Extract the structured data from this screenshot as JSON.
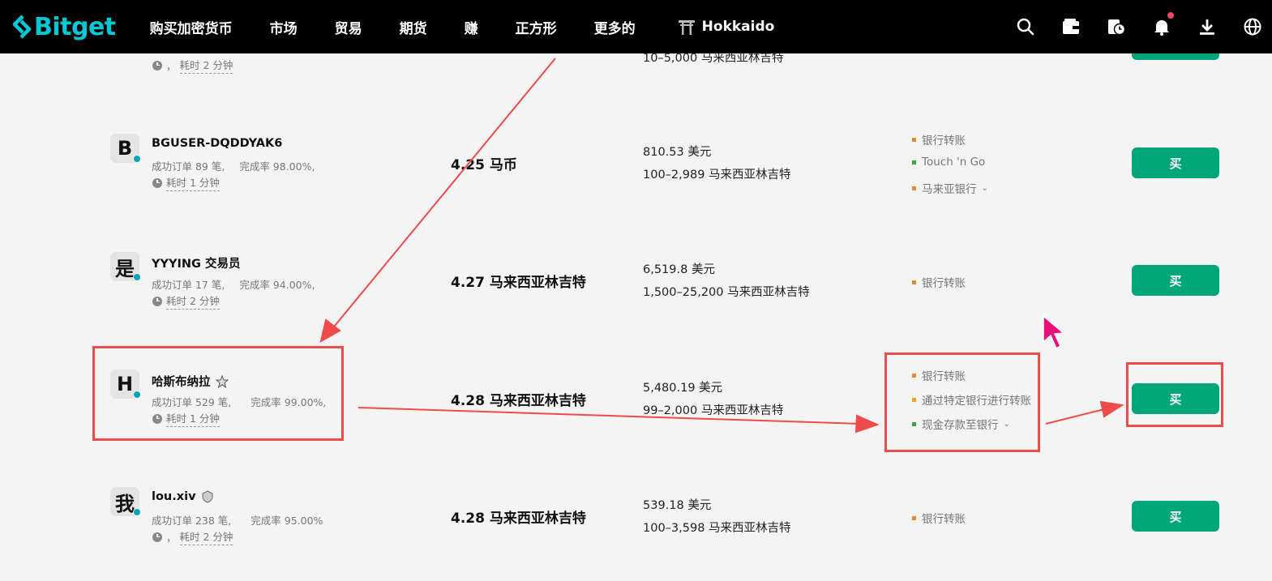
{
  "brand": {
    "name": "Bitget",
    "color": "#00c8d4"
  },
  "nav": {
    "items": [
      "购买加密货币",
      "市场",
      "贸易",
      "期货",
      "赚",
      "正方形",
      "更多的"
    ],
    "community": "Hokkaido"
  },
  "top_icons": [
    "search-icon",
    "wallet-icon",
    "order-history-icon",
    "bell-icon",
    "download-icon",
    "globe-icon"
  ],
  "top_row": {
    "time_prefix": "，",
    "time": "耗时 2 分钟",
    "limit": "10–5,000 马来西亚林吉特"
  },
  "offers": [
    {
      "avatar": "B",
      "name": "BGUSER-DQDDYAK6",
      "badge": "",
      "orders": "成功订单 89 笔,",
      "completion": "完成率 98.00%,",
      "time_prefix": "",
      "time": "耗时 1 分钟",
      "price": "4.25 马币",
      "available": "810.53 美元",
      "limit": "100–2,989 马来西亚林吉特",
      "payments": [
        {
          "label": "银行转账",
          "color": "#e8892a"
        },
        {
          "label": "Touch 'n Go",
          "color": "#3fa535"
        },
        {
          "label": "马来亚银行",
          "color": "#e8892a",
          "more": true
        }
      ],
      "buy": "买"
    },
    {
      "avatar": "是",
      "name": "YYYING 交易员",
      "badge": "",
      "orders": "成功订单 17 笔,",
      "completion": "完成率 94.00%,",
      "time_prefix": "",
      "time": "耗时 2 分钟",
      "price": "4.27 马来西亚林吉特",
      "available": "6,519.8 美元",
      "limit": "1,500–25,200 马来西亚林吉特",
      "payments": [
        {
          "label": "银行转账",
          "color": "#e8892a"
        }
      ],
      "buy": "买"
    },
    {
      "avatar": "H",
      "name": "哈斯布纳拉",
      "badge": "star-badge-icon",
      "orders": "成功订单 529 笔,",
      "completion": "完成率 99.00%,",
      "time_prefix": "",
      "time": "耗时 1 分钟",
      "price": "4.28 马来西亚林吉特",
      "available": "5,480.19 美元",
      "limit": "99–2,000 马来西亚林吉特",
      "payments": [
        {
          "label": "银行转账",
          "color": "#e8892a"
        },
        {
          "label": "通过特定银行进行转账",
          "color": "#e8a32a"
        },
        {
          "label": "现金存款至银行",
          "color": "#3fa535",
          "more": true
        }
      ],
      "buy": "买"
    },
    {
      "avatar": "我",
      "name": "lou.xiv",
      "badge": "shield-badge-icon",
      "orders": "成功订单 238 笔,",
      "completion": "完成率 95.00%",
      "time_prefix": "，",
      "time": "耗时 2 分钟",
      "price": "4.28 马来西亚林吉特",
      "available": "539.18 美元",
      "limit": "100–3,598 马来西亚林吉特",
      "payments": [
        {
          "label": "银行转账",
          "color": "#e8892a"
        }
      ],
      "buy": "买"
    }
  ],
  "colors": {
    "buy": "#00a57a",
    "annotation": "#ee4b4b",
    "cursor": "#e8107a",
    "online_dot": "#0aa3b8"
  }
}
